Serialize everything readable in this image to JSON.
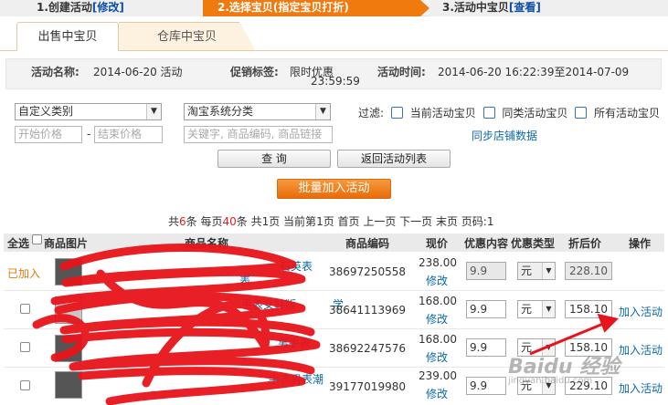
{
  "steps": {
    "step1": "1.创建活动",
    "step1_link": "[修改]",
    "step2": "2.选择宝贝(指定宝贝打折)",
    "step3": "3.活动中宝贝",
    "step3_link": "[查看]"
  },
  "tabs": [
    "出售中宝贝",
    "仓库中宝贝"
  ],
  "info": {
    "name_label": "活动名称:",
    "name_value": "2014-06-20 活动",
    "tag_label": "促销标签:",
    "tag_value": "限时优惠",
    "time_label": "活动时间:",
    "time_value": "2014-06-20 16:22:39至2014-07-09",
    "time_value_cont": "23:59:59"
  },
  "filters": {
    "custom_category": "自定义类别",
    "taobao_category": "淘宝系统分类",
    "start_price_placeholder": "开始价格",
    "dash": "-",
    "end_price_placeholder": "结束价格",
    "keyword_placeholder": "关键字, 商品编码, 商品链接",
    "filter_label": "过滤:",
    "opt_current": "当前活动宝贝",
    "opt_same": "同类活动宝贝",
    "opt_all": "所有活动宝贝",
    "sync_link": "同步店铺数据",
    "query_button": "查 询",
    "back_button": "返回活动列表",
    "batch_button": "批量加入活动"
  },
  "pager": {
    "p1": "共",
    "total": "6",
    "p2": "条 每页",
    "per_page": "40",
    "p3": "条 共",
    "pages": "1",
    "p4": "页 当前第",
    "current": "1",
    "p5": "页 首页 上一页 下一页 末页 页码:",
    "page_no": "1"
  },
  "table": {
    "headers": [
      "全选",
      "商品图片",
      "商品名称",
      "商品编码",
      "现价",
      "优惠内容",
      "优惠类型",
      "折后价",
      "操作"
    ],
    "rows": [
      {
        "status": "已加入",
        "name1": "石英表",
        "name2": "表",
        "code": "38697250558",
        "price": "238.00",
        "edit": "修改",
        "discount": "9.9",
        "unit": "元",
        "after": "228.10",
        "action": ""
      },
      {
        "status": "",
        "name1": "手表女韩版",
        "name2": "学",
        "code": "38641113969",
        "price": "168.00",
        "edit": "修改",
        "discount": "9.9",
        "unit": "元",
        "after": "158.10",
        "action": "加入活动"
      },
      {
        "status": "",
        "name1": "男手表",
        "name2": "",
        "code": "38692247576",
        "price": "168.00",
        "edit": "修改",
        "discount": "9.9",
        "unit": "元",
        "after": "158.10",
        "action": "加入活动"
      },
      {
        "status": "",
        "name1": "手表男表潮",
        "name2": "",
        "code": "39177019980",
        "price": "239.00",
        "edit": "修改",
        "discount": "9.9",
        "unit": "元",
        "after": "229.10",
        "action": "加入活动"
      }
    ]
  },
  "watermark": {
    "brand": "Baidu 经验",
    "sub": "jingyan.baidu.com"
  },
  "colors": {
    "accent": "#f07a0e",
    "link": "#0b6aa8",
    "scribble": "#e8141b"
  }
}
